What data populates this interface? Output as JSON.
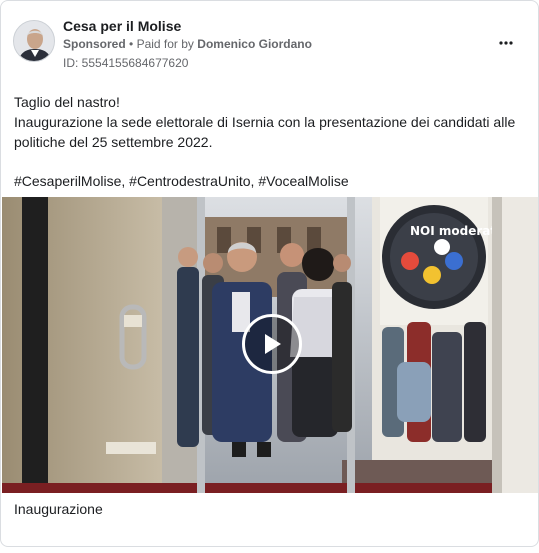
{
  "ad": {
    "page_name": "Cesa per il Molise",
    "sponsored_label": "Sponsored",
    "separator": "•",
    "paid_for_prefix": "Paid for by",
    "paid_for_name": "Domenico Giordano",
    "id_label": "ID: 5554155684677620",
    "more_icon": "more-horizontal-icon"
  },
  "body": {
    "line1": "Taglio del nastro!",
    "line2": "Inaugurazione la sede elettorale di Isernia con la presentazione dei candidati alle",
    "line3": "politiche del 25 settembre 2022.",
    "hashtags": "#CesaperilMolise, #CentrodestraUnito, #VocealMolise"
  },
  "media": {
    "type": "video",
    "play_icon": "play-icon",
    "poster_text": "NOI moderati"
  },
  "caption": "Inaugurazione"
}
